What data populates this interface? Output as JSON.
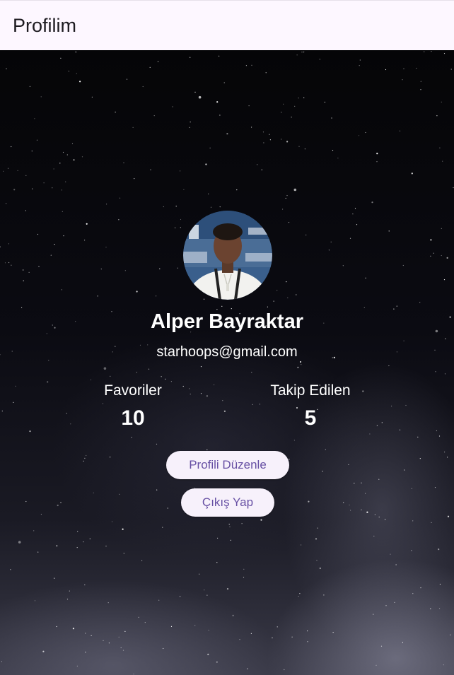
{
  "appbar": {
    "title": "Profilim"
  },
  "profile": {
    "name": "Alper Bayraktar",
    "email": "starhoops@gmail.com",
    "avatar_icon": "profile-photo"
  },
  "stats": {
    "favorites_label": "Favoriler",
    "favorites_value": "10",
    "following_label": "Takip Edilen",
    "following_value": "5"
  },
  "actions": {
    "edit_profile_label": "Profili Düzenle",
    "logout_label": "Çıkış Yap"
  },
  "colors": {
    "appbar_bg": "#fdf7ff",
    "button_bg": "#f7f1fb",
    "button_text": "#6750a4",
    "text_on_bg": "#ffffff"
  }
}
